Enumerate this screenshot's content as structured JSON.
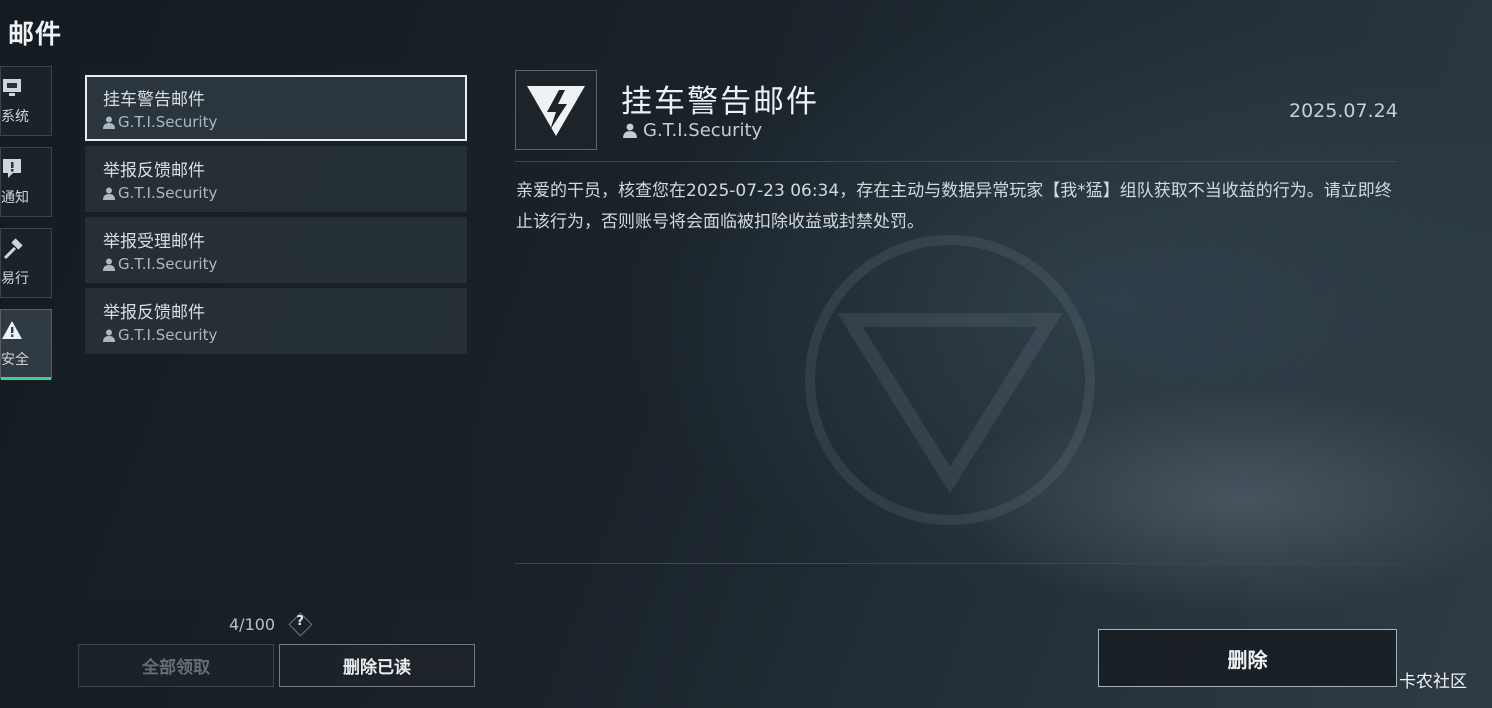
{
  "header": {
    "title": "邮件"
  },
  "rail": {
    "items": [
      {
        "label": "系统",
        "icon": "monitor-icon"
      },
      {
        "label": "通知",
        "icon": "notification-icon"
      },
      {
        "label": "易行",
        "icon": "hammer-icon"
      },
      {
        "label": "安全",
        "icon": "warning-icon",
        "active": true
      }
    ]
  },
  "mail_list": {
    "items": [
      {
        "subject": "挂车警告邮件",
        "sender": "G.T.I.Security",
        "selected": true
      },
      {
        "subject": "举报反馈邮件",
        "sender": "G.T.I.Security"
      },
      {
        "subject": "举报受理邮件",
        "sender": "G.T.I.Security"
      },
      {
        "subject": "举报反馈邮件",
        "sender": "G.T.I.Security"
      }
    ],
    "count": "4/100",
    "help": "?"
  },
  "actions": {
    "claim_all": "全部领取",
    "delete_read": "删除已读"
  },
  "detail": {
    "title": "挂车警告邮件",
    "sender": "G.T.I.Security",
    "date": "2025.07.24",
    "body": "亲爱的干员，核查您在2025-07-23 06:34，存在主动与数据异常玩家【我*猛】组队获取不当收益的行为。请立即终止该行为，否则账号将会面临被扣除收益或封禁处罚。",
    "delete_label": "删除"
  },
  "watermark": "卡农社区",
  "colors": {
    "accent": "#3ed38a",
    "background": "#1a232a"
  }
}
